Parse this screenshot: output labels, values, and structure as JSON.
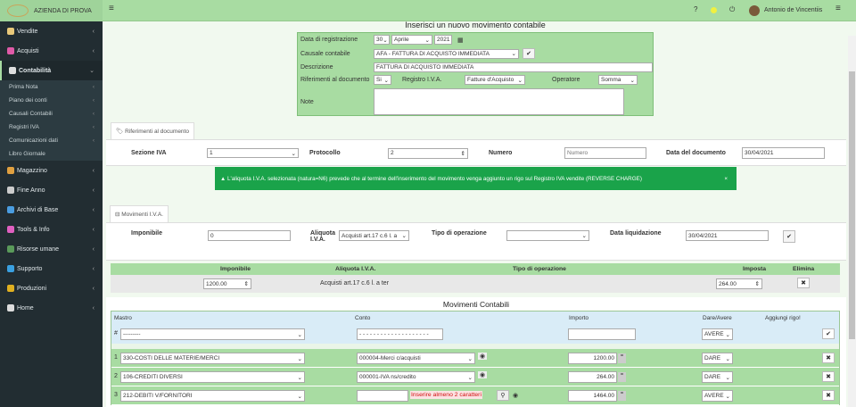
{
  "header": {
    "company": "AZIENDA DI PROVA",
    "logo_text": "Contabilità",
    "user": "Antonio de Vincentiis",
    "help": "?"
  },
  "sidebar": {
    "items": [
      {
        "label": "Vendite",
        "color": "#e8c87a"
      },
      {
        "label": "Acquisti",
        "color": "#e05aa8"
      },
      {
        "label": "Contabilità",
        "color": "#dddddd"
      }
    ],
    "sub": [
      "Prima Nota",
      "Piano dei conti",
      "Causali Contabili",
      "Registri IVA",
      "Comunicazioni dati",
      "Libro Giornale"
    ],
    "items2": [
      {
        "label": "Magazzino",
        "color": "#e0a040"
      },
      {
        "label": "Fine Anno",
        "color": "#cccccc"
      },
      {
        "label": "Archivi di Base",
        "color": "#4a9de0"
      },
      {
        "label": "Tools & Info",
        "color": "#e060c0"
      },
      {
        "label": "Risorse umane",
        "color": "#5a9a5a"
      },
      {
        "label": "Supporto",
        "color": "#3aa0e0"
      },
      {
        "label": "Produzioni",
        "color": "#e0b020"
      },
      {
        "label": "Home",
        "color": "#dddddd"
      }
    ]
  },
  "form": {
    "title": "Inserisci un nuovo movimento contabile",
    "date_label": "Data di registrazione",
    "day": "30",
    "month": "Aprile",
    "year": "2021",
    "causale_label": "Causale contabile",
    "causale": "AFA - FATTURA DI ACQUISTO IMMEDIATA",
    "desc_label": "Descrizione",
    "desc": "FATTURA DI ACQUISTO IMMEDIATA",
    "rif_label": "Riferimenti al documento",
    "rif": "Si",
    "registro_label": "Registro I.V.A.",
    "registro": "Fatture d'Acquisto",
    "operatore_label": "Operatore",
    "operatore": "Somma",
    "note_label": "Note"
  },
  "rif_doc": {
    "tab": "Riferimenti al documento",
    "sezione_label": "Sezione IVA",
    "sezione": "1",
    "protocollo_label": "Protocollo",
    "protocollo": "2",
    "numero_label": "Numero",
    "numero_placeholder": "Numero",
    "data_label": "Data del documento",
    "data": "30/04/2021"
  },
  "alert": {
    "text": "L'aliquota I.V.A. selezionata (natura=N6) prevede che al termine dell'inserimento del movimento venga aggiunto un rigo sul Registro IVA vendite (REVERSE CHARGE)",
    "close": "×"
  },
  "mov_iva": {
    "tab": "Movimenti I.V.A.",
    "imponibile_label": "Imponibile",
    "imponibile": "0",
    "aliquota_label": "Aliquota I.V.A.",
    "aliquota": "Acquisti art.17 c.6 l. a",
    "tipo_label": "Tipo di operazione",
    "tipo": "",
    "data_liq_label": "Data liquidazione",
    "data_liq": "30/04/2021",
    "table": {
      "headers": [
        "Imponibile",
        "Aliquota I.V.A.",
        "Tipo di operazione",
        "Imposta",
        "Elimina"
      ],
      "row": {
        "imponibile": "1200.00",
        "aliquota": "Acquisti art.17 c.6 l. a ter",
        "tipo": "",
        "imposta": "264.00"
      }
    }
  },
  "mov_cont": {
    "title": "Movimenti Contabili",
    "headers": [
      "Mastro",
      "Conto",
      "Importo",
      "Dare/Avere",
      "Aggiungi rigo!"
    ],
    "new_row": {
      "hash": "#",
      "mastro": "---------",
      "conto": "- - - - - - - - - - - - - - - - - - - -",
      "importo": "",
      "da": "AVERE"
    },
    "rows": [
      {
        "n": "1",
        "mastro": "330-COSTI DELLE MATERIE/MERCI",
        "conto": "000004-Merci c/acquisti",
        "importo": "1200.00",
        "da": "DARE"
      },
      {
        "n": "2",
        "mastro": "106-CREDITI DIVERSI",
        "conto": "000001-IVA ns/credito",
        "importo": "264.00",
        "da": "DARE"
      },
      {
        "n": "3",
        "mastro": "212-DEBITI V/FORNITORI",
        "conto": "",
        "importo": "1464.00",
        "da": "AVERE",
        "warning": "Inserire almeno 2 caratteri"
      }
    ]
  }
}
